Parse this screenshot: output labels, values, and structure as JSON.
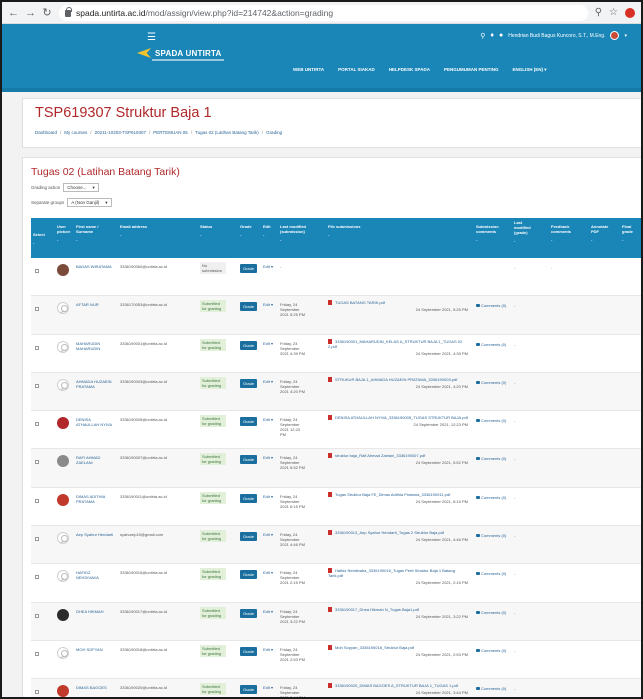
{
  "browser": {
    "url_host": "spada.untirta.ac.id",
    "url_path": "/mod/assign/view.php?id=214742&action=grading"
  },
  "header": {
    "menu_icon": "hamburger-icon",
    "logo_text": "SPADA UNTIRTA",
    "user_name": "Hendrian Budi Bagus Kuncoro, S.T., M.Eng.",
    "nav": [
      "WEB UNTIRTA",
      "PORTAL SIAKAD",
      "HELPDESK SPADA",
      "PENGUMUMAN PENTING",
      "ENGLISH (EN) ▾"
    ]
  },
  "page": {
    "title": "TSP619307 Struktur Baja 1",
    "breadcrumb": [
      "Dashboard",
      "My courses",
      "20211-10203-TSP619307",
      "PERTEMUAN 05",
      "Tugas 02 (Latihan Batang Tarik)",
      "Grading"
    ]
  },
  "assignment": {
    "title": "Tugas 02 (Latihan Batang Tarik)",
    "grading_action_label": "Grading action",
    "grading_action_value": "Choose...",
    "separate_groups_label": "Separate groups",
    "separate_groups_value": "A (Non Ganjil)"
  },
  "table": {
    "headers": {
      "select": "Select",
      "user_picture": "User picture",
      "name": "First name / Surname",
      "email": "Email address",
      "status": "Status",
      "grade": "Grade",
      "edit": "Edit",
      "last_modified": "Last modified (submission)",
      "files": "File submissions",
      "comments": "Submission comments",
      "last_modified_grade": "Last modified (grade)",
      "feedback": "Feedback comments",
      "annotate": "Annotate PDF",
      "final": "Final grade"
    },
    "dash": "-",
    "grade_label": "Grade",
    "edit_label": "Edit ▾",
    "comments_label": "Comments (0)",
    "rows": [
      {
        "name": "BADAS WIRATAMA",
        "email": "3336190060@untirta.ac.id",
        "status": "No submission",
        "status_kind": "none",
        "modified": "-",
        "file": "",
        "file_date": "",
        "comments": "",
        "pic": "photo",
        "pic_color": "#7a4a3a"
      },
      {
        "name": "AFTAR NUR",
        "email": "3336170053@untirta.ac.id",
        "status": "Submitted for grading",
        "status_kind": "submitted",
        "modified": "Friday, 24 September 2021 5:25 PM",
        "file": "TUGAS BATANG TARIK.pdf",
        "file_date": "24 September 2021, 5:25 PM",
        "comments": "Comments (0)",
        "pic": "generic",
        "pic_color": ""
      },
      {
        "name": "MAHARUDIN MAHARUDIN",
        "email": "3336190001@untirta.ac.id",
        "status": "Submitted for grading",
        "status_kind": "submitted",
        "modified": "Friday, 24 September 2021 4:39 PM",
        "file": "3336190001_MAHARUDIN_KELAS A_STRUKTUR BAJA 1_TUGAS 02 2.pdf",
        "file_date": "24 September 2021, 4:39 PM",
        "comments": "Comments (0)",
        "pic": "generic",
        "pic_color": ""
      },
      {
        "name": "AHMADA HUZAEIN PRATAMA",
        "email": "3336190003@untirta.ac.id",
        "status": "Submitted for grading",
        "status_kind": "submitted",
        "modified": "Friday, 24 September 2021 4:20 PM",
        "file": "STRUKUR BAJA 1_AHMADA HUZAEIN PRATAMA_3336190003.pdf",
        "file_date": "24 September 2021, 4:20 PM",
        "comments": "Comments (0)",
        "pic": "generic",
        "pic_color": ""
      },
      {
        "name": "DENISA ATHAULLAH NYIVA",
        "email": "3336190005@untirta.ac.id",
        "status": "Submitted for grading",
        "status_kind": "submitted",
        "modified": "Friday, 24 September 2021 12:23 PM",
        "file": "DENISA ATHAULLAH NYIVA_3336190005_TUGAS STRUKTUR BAJA.pdf",
        "file_date": "24 September 2021, 12:23 PM",
        "comments": "Comments (0)",
        "pic": "photo",
        "pic_color": "#b0282a"
      },
      {
        "name": "RAFI AHMAD ZAELANI",
        "email": "3336190007@untirta.ac.id",
        "status": "Submitted for grading",
        "status_kind": "submitted",
        "modified": "Friday, 24 September 2021 5:52 PM",
        "file": "struktur baja_Rafi Ahmad Zaelani_3336190007.pdf",
        "file_date": "24 September 2021, 5:52 PM",
        "comments": "Comments (0)",
        "pic": "photo",
        "pic_color": "#8a8a8a"
      },
      {
        "name": "DIMAS ADITHIA PRATAMA",
        "email": "3336190011@untirta.ac.id",
        "status": "Submitted for grading",
        "status_kind": "submitted",
        "modified": "Friday, 24 September 2021 6:15 PM",
        "file": "Tugas Struktur Baja FE_Dimas Adithia Pratama_3336190011.pdf",
        "file_date": "24 September 2021, 6:15 PM",
        "comments": "Comments (0)",
        "pic": "photo",
        "pic_color": "#c0392b"
      },
      {
        "name": "Aep Syahur Hendarti",
        "email": "syahurep15@gmail.com",
        "status": "Submitted for grading",
        "status_kind": "submitted",
        "modified": "Friday, 24 September 2021 4:46 PM",
        "file": "3336190013_Aep Syahur Hendarti_Tugas 2 Struktur Baja.pdf",
        "file_date": "24 September 2021, 4:46 PM",
        "comments": "Comments (0)",
        "pic": "generic",
        "pic_color": ""
      },
      {
        "name": "HAFIDZ NEHDIVAKA",
        "email": "3336190016@untirta.ac.id",
        "status": "Submitted for grading",
        "status_kind": "submitted",
        "modified": "Friday, 24 September 2021 2:15 PM",
        "file": "Hafidz Nehdivaka_3336190016_Tugas Pertt Struktur Baja 1 Batang Tarik.pdf",
        "file_date": "24 September 2021, 2:15 PM",
        "comments": "Comments (0)",
        "pic": "generic",
        "pic_color": ""
      },
      {
        "name": "DHEA HIKMAH",
        "email": "3336190017@untirta.ac.id",
        "status": "Submitted for grading",
        "status_kind": "submitted",
        "modified": "Friday, 24 September 2021 3:22 PM",
        "file": "3336190017_Dhea Hikmah N_Tugas Baja1.pdf",
        "file_date": "24 September 2021, 3:22 PM",
        "comments": "Comments (0)",
        "pic": "photo",
        "pic_color": "#2b2b2b"
      },
      {
        "name": "MOH SOFYAN",
        "email": "3336190018@untirta.ac.id",
        "status": "Submitted for grading",
        "status_kind": "submitted",
        "modified": "Friday, 24 September 2021 2:53 PM",
        "file": "Moh Sopyan_3336190018_Struktur Baja.pdf",
        "file_date": "24 September 2021, 2:53 PM",
        "comments": "Comments (0)",
        "pic": "generic",
        "pic_color": ""
      },
      {
        "name": "DIMAS BAGOES",
        "email": "3336190020@untirta.ac.id",
        "status": "Submitted for grading",
        "status_kind": "submitted",
        "modified": "Friday, 24 September 2021 3:44 PM",
        "file": "3336190020_DIMAS BAGOES A_STRUKTUR BAJA 1_TUGAS 1.pdf",
        "file_date": "24 September 2021, 3:44 PM",
        "comments": "Comments (0)",
        "pic": "photo",
        "pic_color": "#c0392b"
      }
    ]
  },
  "colors": {
    "header": "#1a86b8",
    "title": "#b0282a",
    "link": "#2a6496"
  }
}
